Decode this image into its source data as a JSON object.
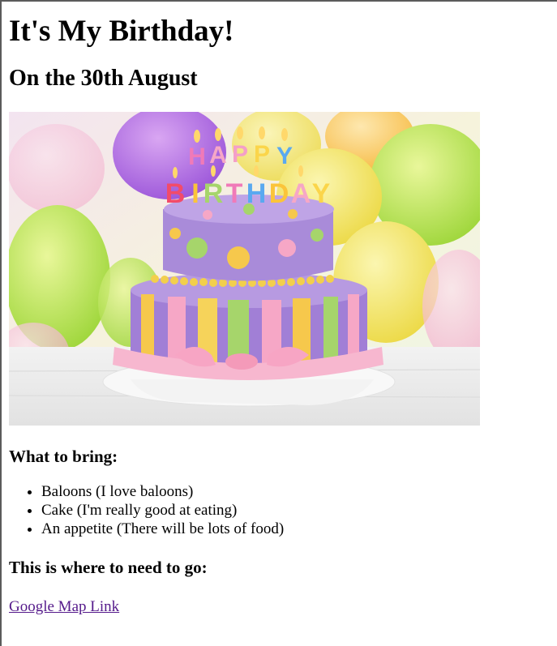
{
  "page": {
    "title": "It's My Birthday!",
    "subtitle": "On the 30th August",
    "image": {
      "description_icon": "birthday-cake",
      "candles_text": [
        "HAPPY",
        "BIRTHDAY"
      ]
    },
    "bring_heading": "What to bring:",
    "bring_items": [
      "Baloons (I love baloons)",
      "Cake (I'm really good at eating)",
      "An appetite (There will be lots of food)"
    ],
    "where_heading": "This is where to need to go:",
    "map_link": "Google Map Link"
  },
  "colors": {
    "link_visited": "#551a8b",
    "text": "#000000",
    "background": "#ffffff"
  }
}
